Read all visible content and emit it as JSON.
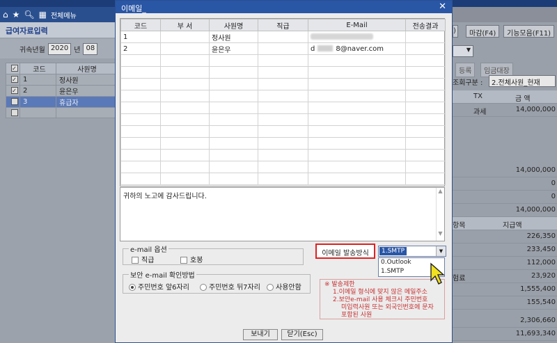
{
  "nav": {
    "menu_label": "전체메뉴"
  },
  "left": {
    "title": "급여자료입력",
    "period_label": "귀속년월",
    "year": "2020",
    "year_unit": "년",
    "month": "08",
    "columns": [
      "코드",
      "사원명"
    ],
    "rows": [
      {
        "checked": true,
        "code": "1",
        "name": "정사원",
        "selected": false
      },
      {
        "checked": true,
        "code": "2",
        "name": "윤은우",
        "selected": false
      },
      {
        "checked": false,
        "code": "3",
        "name": "휴급자",
        "selected": true
      }
    ]
  },
  "right": {
    "close_label": "마감(F4)",
    "tools_label": "기능모음(F11)",
    "tab_register": "등록",
    "tab_ledger": "임금대장",
    "filter_label": "조회구분 :",
    "filter_value": "2.전체사원_현재",
    "col_tx": "TX",
    "col_amount": "금 액",
    "tax_label": "과세",
    "first_amount": "14,000,000",
    "totals": [
      "14,000,000",
      "0",
      "0",
      "14,000,000"
    ],
    "deduct_col_item": "항목",
    "deduct_col_amount": "지급액",
    "deduct_label": "험료",
    "deductions": [
      "226,350",
      "233,450",
      "112,000",
      "23,920",
      "1,555,400",
      "155,540"
    ],
    "sum1": "2,306,660",
    "sum2": "11,693,340"
  },
  "dialog": {
    "title": "이메일_",
    "columns": [
      "코드",
      "부 서",
      "사원명",
      "직급",
      "E-Mail",
      "전송결과"
    ],
    "rows": [
      {
        "code": "1",
        "dept": "",
        "name": "정사원",
        "rank": "",
        "email_prefix": "",
        "email_suffix": ""
      },
      {
        "code": "2",
        "dept": "",
        "name": "윤은우",
        "rank": "",
        "email_prefix": "d",
        "email_suffix": "8@naver.com"
      }
    ],
    "message": "귀하의 노고에 감사드립니다.",
    "options_legend": "e-mail 옵션",
    "opt_rank": "직급",
    "opt_pay": "호봉",
    "security_legend": "보안 e-mail 확인방법",
    "sec_options": [
      "주민번호 앞6자리",
      "주민번호 뒤7자리",
      "사용안함"
    ],
    "send_method_label": "이메일 발송방식",
    "send_method_value": "1.SMTP",
    "send_method_options": [
      "0.Outlook",
      "1.SMTP"
    ],
    "warn_title": "※ 발송제한",
    "warn_1": "1.이메일 형식에 맞지 않은 메일주소",
    "warn_2": "2.보안e-mail 사용 체크시 주민번호",
    "warn_3": "미입력사원 또는 외국인번호에 문자",
    "warn_4": "포함된 사원",
    "send_button": "보내기",
    "close_button": "닫기(Esc)"
  },
  "colors": {
    "title_bar": "#2a56a6",
    "highlight": "#e02020",
    "warning": "#c83030"
  }
}
